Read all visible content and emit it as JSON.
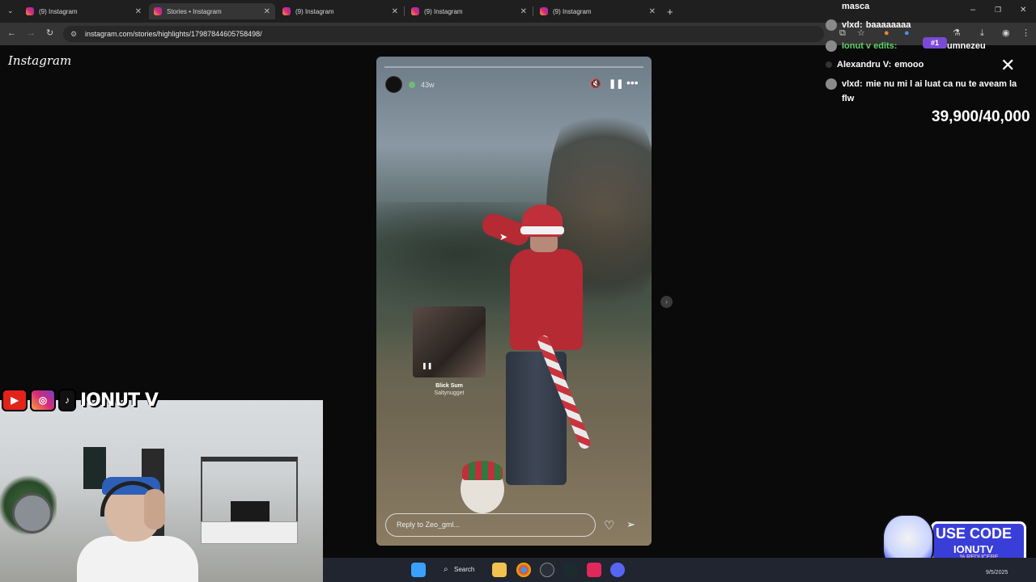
{
  "browser": {
    "tabs": [
      {
        "label": "(9) Instagram",
        "active": false
      },
      {
        "label": "Stories • Instagram",
        "active": true
      },
      {
        "label": "(9) Instagram",
        "active": false
      },
      {
        "label": "(9) Instagram",
        "active": false
      },
      {
        "label": "(9) Instagram",
        "active": false
      }
    ],
    "url": "instagram.com/stories/highlights/17987844605758498/"
  },
  "instagram": {
    "logo": "Instagram",
    "story": {
      "time": "43w",
      "music_title": "Blick Sum",
      "music_artist": "Saltynugget",
      "reply_placeholder": "Reply to Zeo_gml..."
    }
  },
  "chat": {
    "messages": [
      {
        "name": "",
        "text": "masca"
      },
      {
        "name": "vlxd:",
        "text": "baaaaaaaa"
      },
      {
        "name": "Ionut v edits:",
        "text": "w Dumnezeu"
      },
      {
        "name": "Alexandru V:",
        "text": "emooo"
      },
      {
        "name": "vlxd:",
        "text": "mie nu mi l ai luat ca nu te aveam la"
      },
      {
        "name": "",
        "text": "flw"
      }
    ],
    "rank_badge": "#1",
    "goal": "39,900/40,000"
  },
  "stream": {
    "handle": "IONUT V",
    "promo_line1": "USE CODE",
    "promo_line2": "IONUTV",
    "promo_line3": "% REDUCERE"
  },
  "taskbar": {
    "search_label": "Search",
    "date": "9/5/2025"
  },
  "colors": {
    "chat_highlight": "#5fd26a",
    "promo_bg": "#3a3ed8"
  }
}
